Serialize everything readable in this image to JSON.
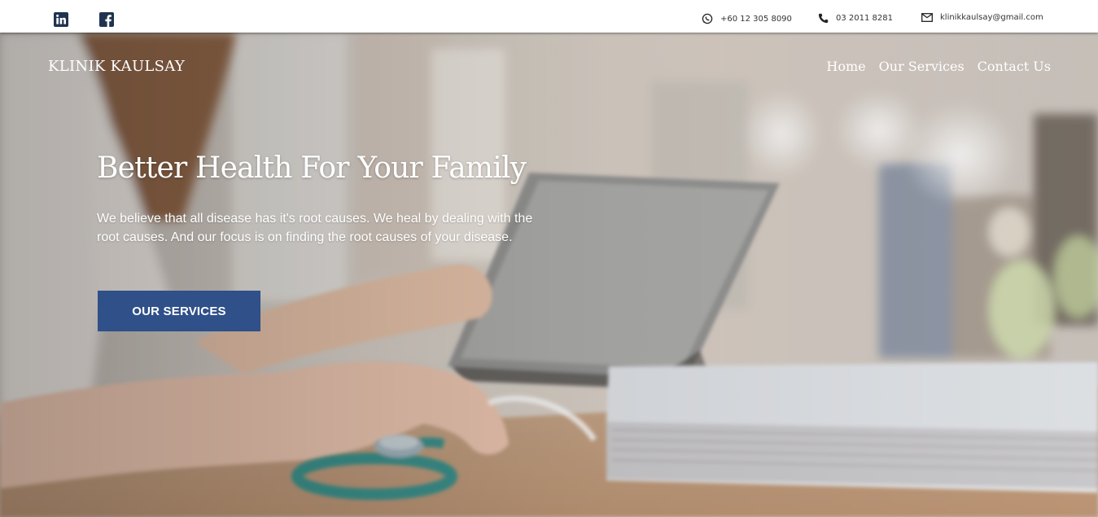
{
  "topbar": {
    "social": [
      {
        "icon": "linkedin-icon"
      },
      {
        "icon": "facebook-icon"
      }
    ],
    "contacts": {
      "whatsapp": "+60 12 305 8090",
      "phone": "03 2011 8281",
      "email": "klinikkaulsay@gmail.com"
    }
  },
  "header": {
    "brand": "KLINIK KAULSAY",
    "nav": [
      "Home",
      "Our Services",
      "Contact Us"
    ]
  },
  "hero": {
    "title": "Better Health For Your Family",
    "description": "We believe that all disease has it's root causes. We heal by dealing with the root causes. And our focus is on finding the root causes of your disease.",
    "cta_label": "OUR SERVICES"
  },
  "colors": {
    "accent": "#2f5089",
    "social_icon": "#1f3350",
    "topbar_bg": "#ffffff"
  }
}
